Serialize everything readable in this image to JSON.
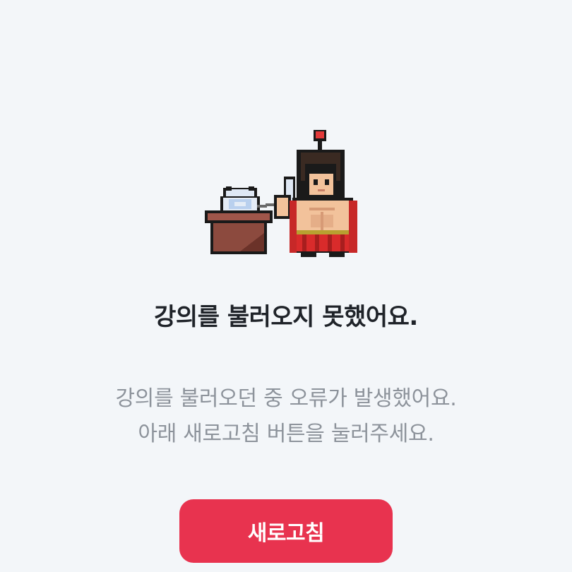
{
  "illustration": {
    "icon": "spartan-warrior-on-phone-pixel-art-icon"
  },
  "message": {
    "title": "강의를 불러오지 못했어요.",
    "description_lines": [
      "강의를 불러오던 중 오류가 발생했어요.",
      "아래 새로고침 버튼을 눌러주세요."
    ]
  },
  "actions": {
    "refresh_label": "새로고침"
  },
  "colors": {
    "background": "#f3f6f9",
    "accent": "#e8334f",
    "title": "#1f2329",
    "description": "#8d939b"
  }
}
